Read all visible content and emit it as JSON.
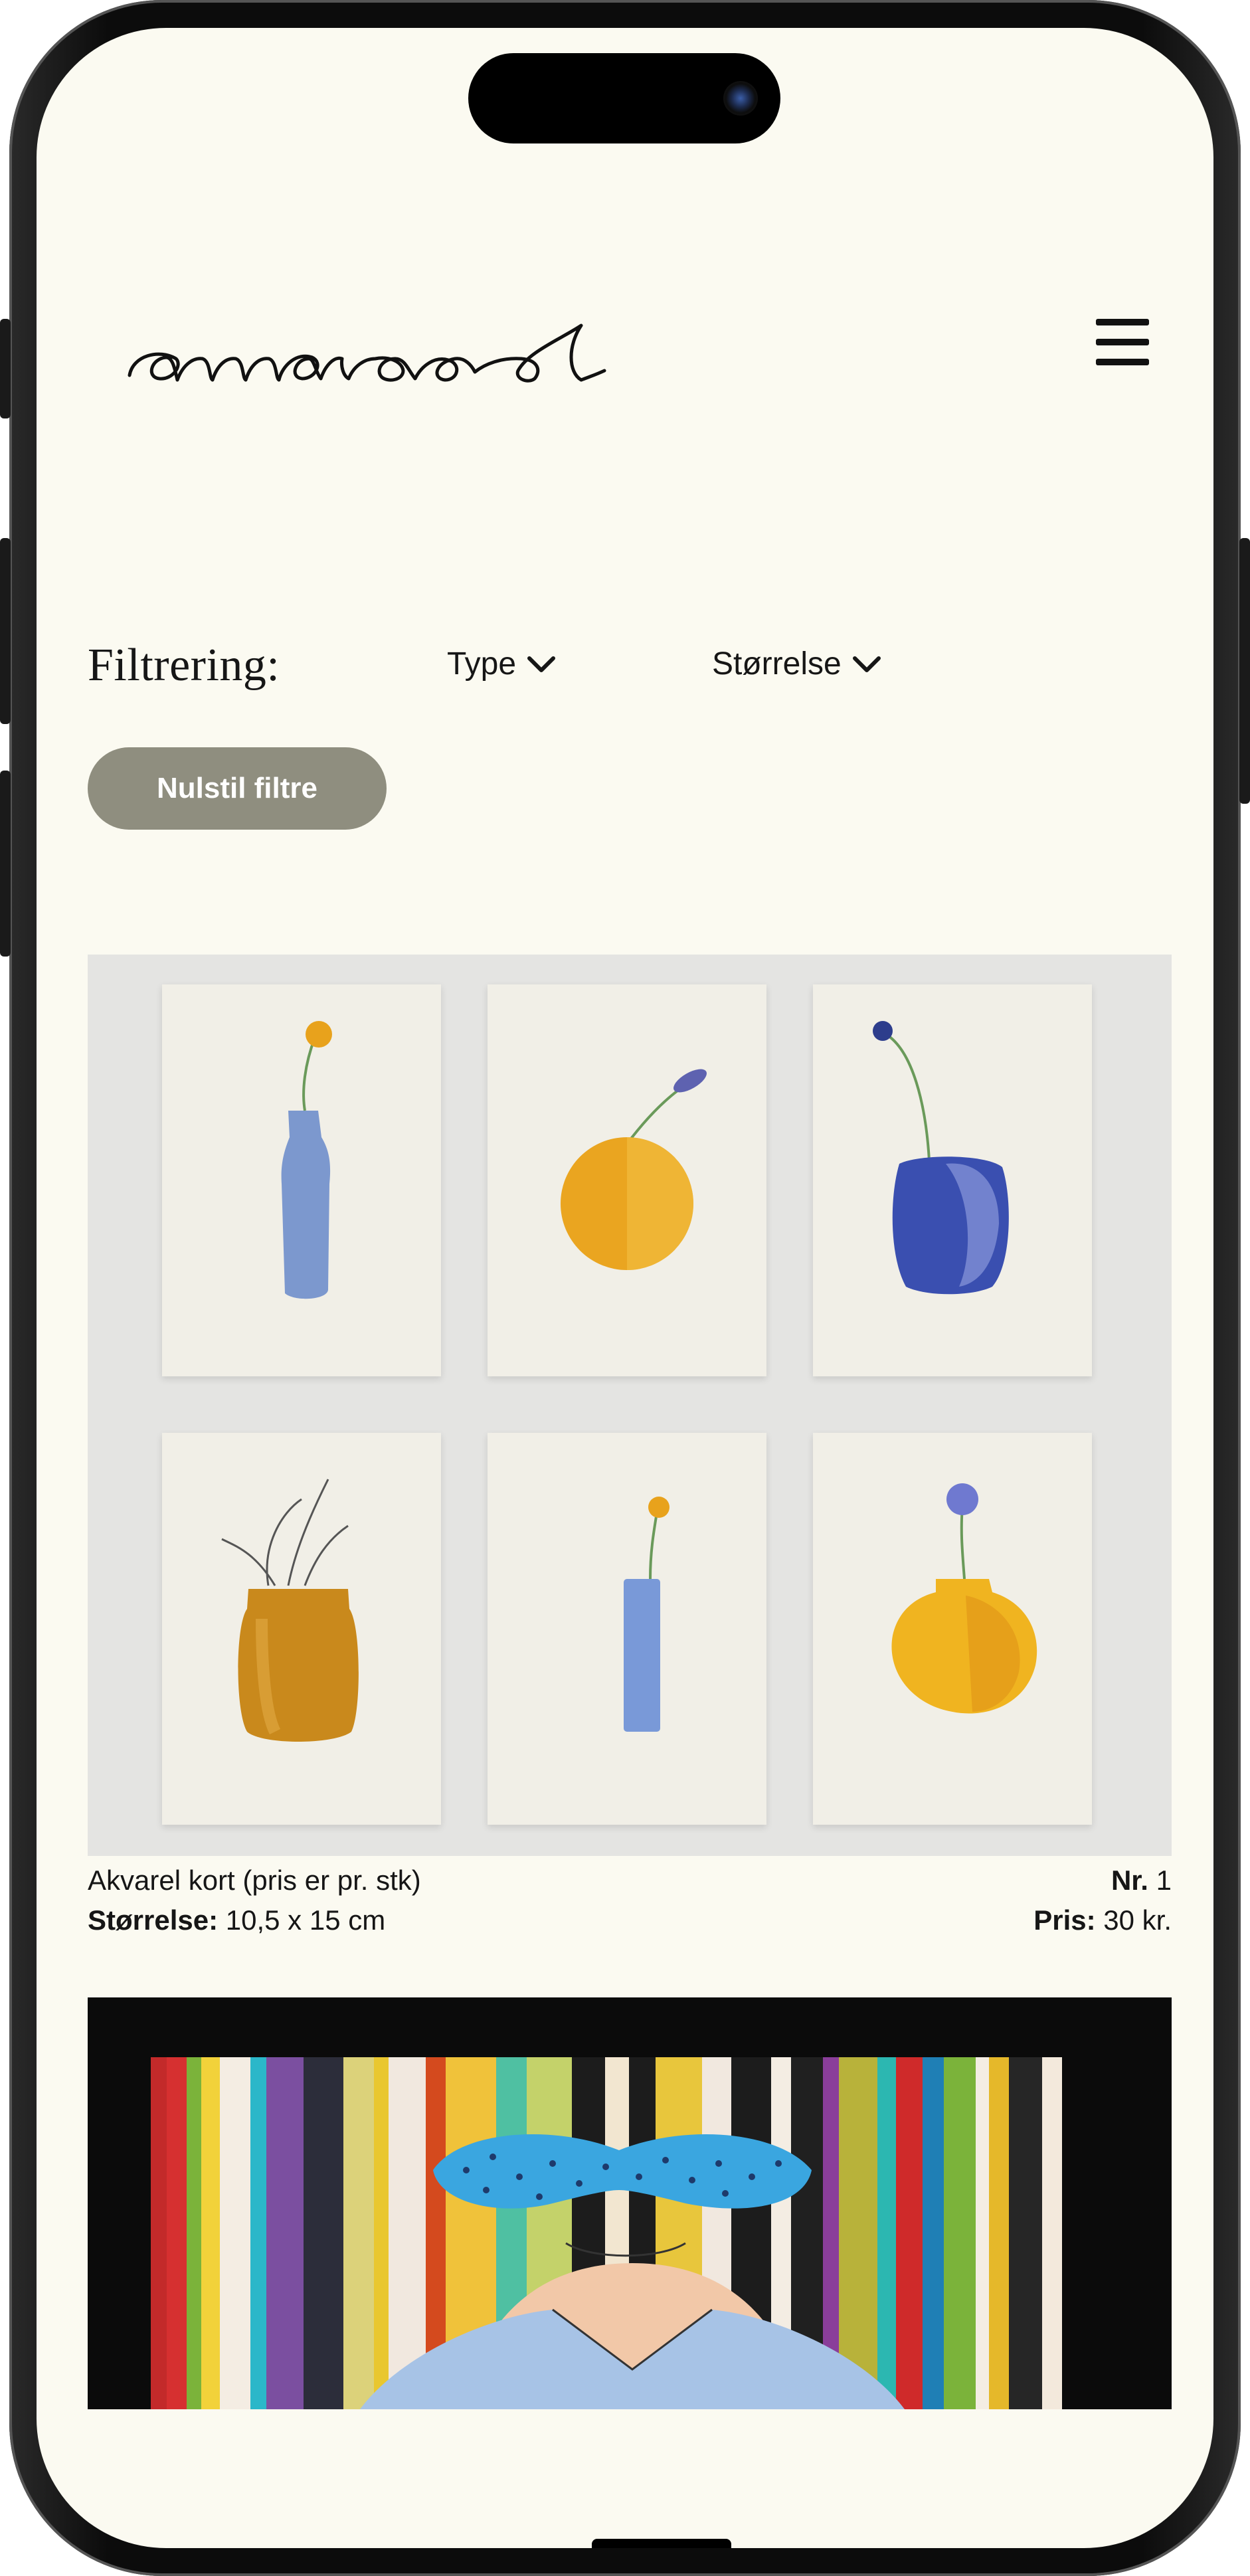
{
  "header": {
    "logo_text": "annarod",
    "menu_icon": "hamburger-icon"
  },
  "filters": {
    "label": "Filtrering:",
    "type_label": "Type",
    "size_label": "Størrelse",
    "dropdown_icon": "chevron-down-icon",
    "reset_label": "Nulstil filtre"
  },
  "products": [
    {
      "title": "Akvarel kort (pris er pr. stk)",
      "size_label": "Størrelse:",
      "size_value": "10,5 x 15 cm",
      "nr_label": "Nr.",
      "nr_value": "1",
      "price_label": "Pris:",
      "price_value": "30 kr."
    }
  ],
  "colors": {
    "background": "#fbfaf1",
    "reset_button": "#8f8e7f",
    "text": "#161616"
  }
}
